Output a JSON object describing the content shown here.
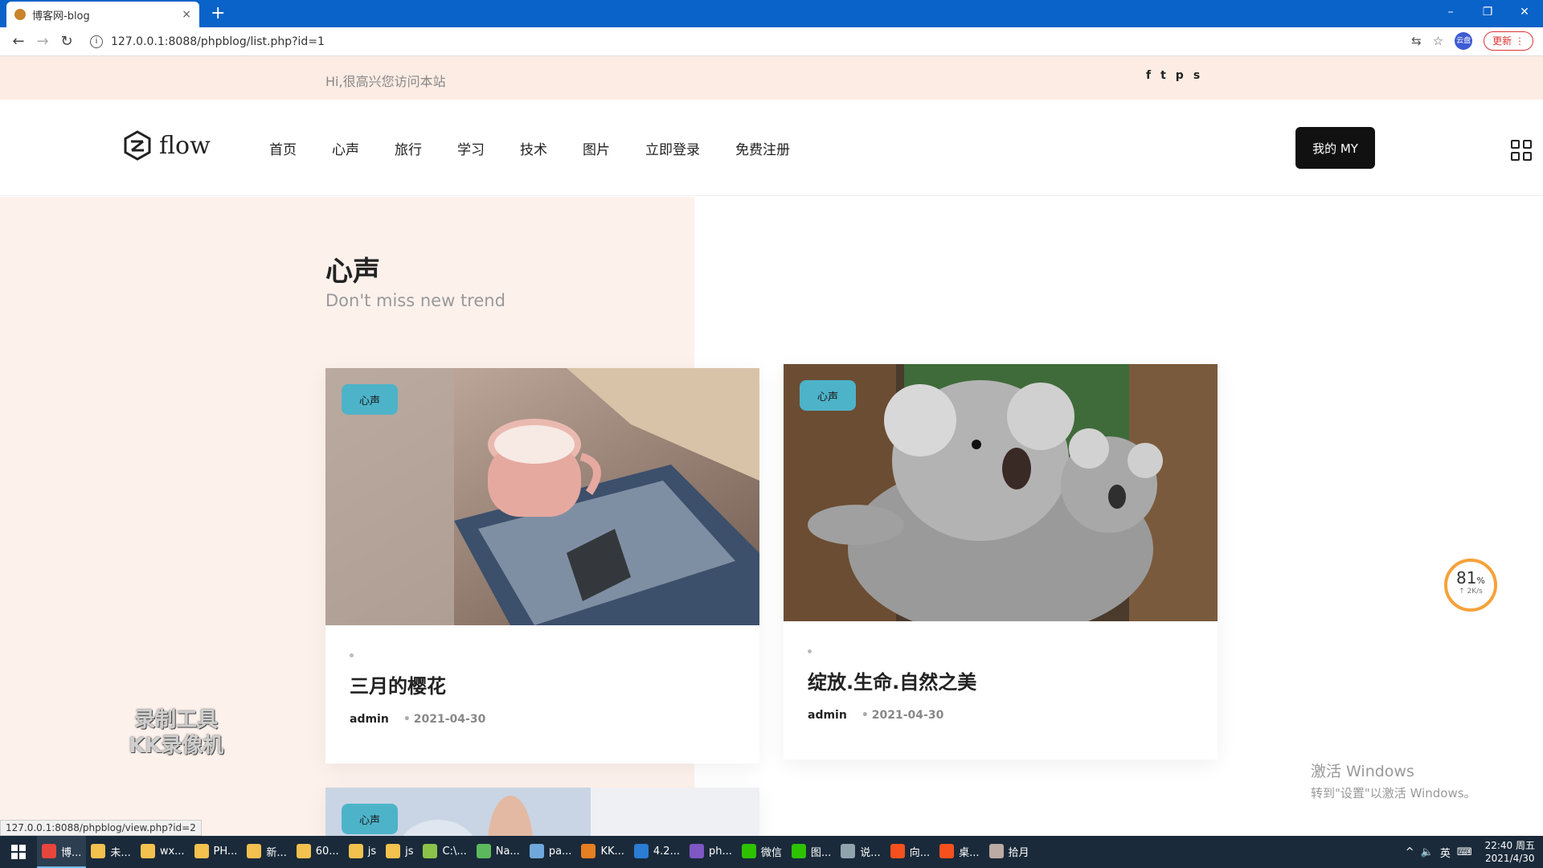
{
  "browser": {
    "tab_title": "博客网-blog",
    "tab_close": "×",
    "new_tab": "+",
    "url": "127.0.0.1:8088/phpblog/list.php?id=1",
    "update_label": "更新",
    "profile_label": "云盘",
    "window_controls": [
      "–",
      "❐",
      "✕"
    ]
  },
  "site": {
    "greeting": "Hi,很高兴您访问本站",
    "social": [
      "f",
      "t",
      "p",
      "s"
    ],
    "logo_text": "flow",
    "nav": [
      "首页",
      "心声",
      "旅行",
      "学习",
      "技术",
      "图片",
      "立即登录",
      "免费注册"
    ],
    "my_button": "我的 MY"
  },
  "section": {
    "title": "心声",
    "subtitle": "Don't miss new trend"
  },
  "cards": [
    {
      "tag": "心声",
      "title": "三月的樱花",
      "author": "admin",
      "date": "2021-04-30"
    },
    {
      "tag": "心声",
      "title": "绽放.生命.自然之美",
      "author": "admin",
      "date": "2021-04-30"
    },
    {
      "tag": "心声"
    }
  ],
  "overlay": {
    "watermark_line1": "录制工具",
    "watermark_line2": "KK录像机",
    "activate_line1": "激活 Windows",
    "activate_line2": "转到\"设置\"以激活 Windows。",
    "speed_pct": "81",
    "speed_unit": "%",
    "speed_rate": "↑ 2K/s",
    "status_url": "127.0.0.1:8088/phpblog/view.php?id=2"
  },
  "taskbar": {
    "items": [
      {
        "label": "博...",
        "color": "#e8453c"
      },
      {
        "label": "未...",
        "color": "#f2c14e"
      },
      {
        "label": "wx...",
        "color": "#f2c14e"
      },
      {
        "label": "PH...",
        "color": "#f2c14e"
      },
      {
        "label": "新...",
        "color": "#f2c14e"
      },
      {
        "label": "60...",
        "color": "#f2c14e"
      },
      {
        "label": "js",
        "color": "#f2c14e"
      },
      {
        "label": "js",
        "color": "#f2c14e"
      },
      {
        "label": "C:\\...",
        "color": "#8bc34a"
      },
      {
        "label": "Na...",
        "color": "#5cb85c"
      },
      {
        "label": "pa...",
        "color": "#6fa8dc"
      },
      {
        "label": "KK...",
        "color": "#e67e22"
      },
      {
        "label": "4.2...",
        "color": "#2b7cd3"
      },
      {
        "label": "ph...",
        "color": "#7e57c2"
      },
      {
        "label": "微信",
        "color": "#2dc100"
      },
      {
        "label": "图...",
        "color": "#2dc100"
      },
      {
        "label": "说...",
        "color": "#90a4ae"
      },
      {
        "label": "向...",
        "color": "#f4511e"
      },
      {
        "label": "桌...",
        "color": "#f4511e"
      },
      {
        "label": "拾月",
        "color": "#bcaaa4"
      }
    ],
    "ime": "英",
    "time": "22:40 周五",
    "date": "2021/4/30"
  }
}
